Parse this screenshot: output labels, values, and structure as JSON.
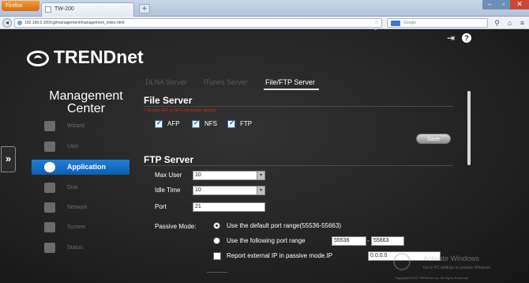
{
  "browser": {
    "menu_button": "Firefox",
    "tab_title": "TW-200",
    "url": "192.168.0.100/cgi/management/management_index.html",
    "url_actions": "☆ ▾ C",
    "search_placeholder": "Google",
    "new_tab": "+",
    "window_min": "–",
    "window_max": "▫",
    "window_close": "✕"
  },
  "header": {
    "logo_text": "TRENDnet",
    "signout_icon": "sign-out-icon",
    "help_icon": "help-icon"
  },
  "sidebar": {
    "title_line1": "Management",
    "title_line2": "Center",
    "items": [
      {
        "label": "Wizard",
        "icon": "wizard-icon",
        "active": false
      },
      {
        "label": "User",
        "icon": "user-icon",
        "active": false
      },
      {
        "label": "Application",
        "icon": "application-icon",
        "active": true
      },
      {
        "label": "Disk",
        "icon": "disk-icon",
        "active": false
      },
      {
        "label": "Network",
        "icon": "network-icon",
        "active": false
      },
      {
        "label": "System",
        "icon": "system-icon",
        "active": false
      },
      {
        "label": "Status",
        "icon": "status-icon",
        "active": false
      }
    ],
    "expander": "»"
  },
  "tabs": [
    {
      "label": "DLNA Server",
      "active": false
    },
    {
      "label": "iTunes Server",
      "active": false
    },
    {
      "label": "File/FTP Server",
      "active": true
    }
  ],
  "file_server": {
    "title": "File Server",
    "note": "(* Enable AFP or NFS will disable eplock)",
    "options": [
      {
        "label": "AFP",
        "checked": true
      },
      {
        "label": "NFS",
        "checked": true
      },
      {
        "label": "FTP",
        "checked": true
      }
    ],
    "save_label": "Save"
  },
  "ftp_server": {
    "title": "FTP Server",
    "max_user_label": "Max User",
    "max_user_value": "10",
    "idle_time_label": "Idle Time",
    "idle_time_value": "10",
    "port_label": "Port",
    "port_value": "21",
    "passive_mode_label": "Passive Mode:",
    "passive_default_label": "Use the default port range(55536-55663)",
    "passive_custom_label": "Use the following port range",
    "port_range_start": "55536",
    "port_range_dash": "-",
    "port_range_end": "55663",
    "report_ip_label": "Report external IP in passive mode.IP",
    "report_ip_value": "0.0.0.0"
  },
  "overlay": {
    "activate_title": "Activate Windows",
    "activate_sub": "Go to PC settings to activate Windows.",
    "copyright": "Copyright©2013 TRENDnet Inc. All Rights Reserved"
  },
  "colors": {
    "accent": "#1a74cf",
    "note_red": "#d12a1c",
    "background": "#222222"
  }
}
